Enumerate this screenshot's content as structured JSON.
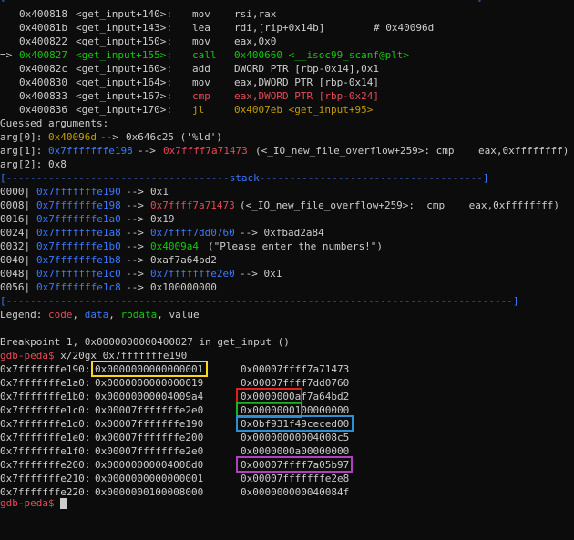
{
  "code_section": {
    "header_label": "code",
    "instructions": [
      {
        "arrow": "",
        "addr": "0x400818",
        "sym": "<get_input+140>:",
        "mnem": "mov",
        "ops": "rsi,rax",
        "comment": ""
      },
      {
        "arrow": "",
        "addr": "0x40081b",
        "sym": "<get_input+143>:",
        "mnem": "lea",
        "ops": "rdi,[rip+0x14b]",
        "comment": "# 0x40096d"
      },
      {
        "arrow": "",
        "addr": "0x400822",
        "sym": "<get_input+150>:",
        "mnem": "mov",
        "ops": "eax,0x0",
        "comment": ""
      },
      {
        "arrow": "=>",
        "addr": "0x400827",
        "sym": "<get_input+155>:",
        "mnem": "call",
        "ops": "0x400660 <__isoc99_scanf@plt>",
        "comment": ""
      },
      {
        "arrow": "",
        "addr": "0x40082c",
        "sym": "<get_input+160>:",
        "mnem": "add",
        "ops": "DWORD PTR [rbp-0x14],0x1",
        "comment": ""
      },
      {
        "arrow": "",
        "addr": "0x400830",
        "sym": "<get_input+164>:",
        "mnem": "mov",
        "ops": "eax,DWORD PTR [rbp-0x14]",
        "comment": ""
      },
      {
        "arrow": "",
        "addr": "0x400833",
        "sym": "<get_input+167>:",
        "mnem": "cmp",
        "ops": "eax,DWORD PTR [rbp-0x24]",
        "comment": ""
      },
      {
        "arrow": "",
        "addr": "0x400836",
        "sym": "<get_input+170>:",
        "mnem": "jl",
        "ops": "0x4007eb <get_input+95>",
        "comment": ""
      }
    ]
  },
  "guessed_arguments": {
    "title": "Guessed arguments:",
    "args": [
      {
        "label": "arg[0]:",
        "ptr": "0x40096d",
        "arrow": "-->",
        "target": "0x646c25 ('%ld')",
        "rest": ""
      },
      {
        "label": "arg[1]:",
        "ptr": "0x7fffffffe198",
        "arrow": "-->",
        "target": "0x7ffff7a71473",
        "rest": "(<_IO_new_file_overflow+259>: cmp    eax,0xffffffff)"
      },
      {
        "label": "arg[2]:",
        "ptr": "",
        "arrow": "",
        "target": "0x8",
        "rest": ""
      }
    ]
  },
  "stack_section": {
    "header_label": "stack",
    "rows": [
      {
        "offset": "0000|",
        "addr": "0x7fffffffe190",
        "arrow": "-->",
        "val": "0x1",
        "rest": ""
      },
      {
        "offset": "0008|",
        "addr": "0x7fffffffe198",
        "arrow": "-->",
        "val": "0x7ffff7a71473",
        "rest": "(<_IO_new_file_overflow+259>:  cmp    eax,0xffffffff)"
      },
      {
        "offset": "0016|",
        "addr": "0x7fffffffe1a0",
        "arrow": "-->",
        "val": "0x19",
        "rest": ""
      },
      {
        "offset": "0024|",
        "addr": "0x7fffffffe1a8",
        "arrow": "-->",
        "val": "0x7ffff7dd0760",
        "rest": "--> 0xfbad2a84"
      },
      {
        "offset": "0032|",
        "addr": "0x7fffffffe1b0",
        "arrow": "-->",
        "val": "0x4009a4",
        "rest": "(\"Please enter the numbers!\")"
      },
      {
        "offset": "0040|",
        "addr": "0x7fffffffe1b8",
        "arrow": "-->",
        "val": "0xaf7a64bd2",
        "rest": ""
      },
      {
        "offset": "0048|",
        "addr": "0x7fffffffe1c0",
        "arrow": "-->",
        "val": "0x7fffffffe2e0",
        "rest": "--> 0x1"
      },
      {
        "offset": "0056|",
        "addr": "0x7fffffffe1c8",
        "arrow": "-->",
        "val": "0x100000000",
        "rest": ""
      }
    ]
  },
  "legend": {
    "label": "Legend:",
    "code": "code",
    "data": "data",
    "rodata": "rodata",
    "value": "value",
    "sep": ","
  },
  "breakpoint_line": "Breakpoint 1, 0x0000000000400827 in get_input ()",
  "prompt": "gdb-peda$",
  "command": "x/20gx 0x7fffffffe190",
  "memory_dump": [
    {
      "addr": "0x7fffffffe190:",
      "v1": "0x0000000000000001",
      "v2": "0x00007ffff7a71473"
    },
    {
      "addr": "0x7fffffffe1a0:",
      "v1": "0x0000000000000019",
      "v2": "0x00007ffff7dd0760"
    },
    {
      "addr": "0x7fffffffe1b0:",
      "v1": "0x00000000004009a4",
      "v2": "0x0000000af7a64bd2"
    },
    {
      "addr": "0x7fffffffe1c0:",
      "v1": "0x00007fffffffe2e0",
      "v2": "0x0000000100000000"
    },
    {
      "addr": "0x7fffffffe1d0:",
      "v1": "0x00007fffffffe190",
      "v2": "0x0bf931f49ceced00"
    },
    {
      "addr": "0x7fffffffe1e0:",
      "v1": "0x00007fffffffe200",
      "v2": "0x00000000004008c5"
    },
    {
      "addr": "0x7fffffffe1f0:",
      "v1": "0x00007fffffffe2e0",
      "v2": "0x0000000a00000000"
    },
    {
      "addr": "0x7fffffffe200:",
      "v1": "0x00000000004008d0",
      "v2": "0x00007ffff7a05b97"
    },
    {
      "addr": "0x7fffffffe210:",
      "v1": "0x0000000000000001",
      "v2": "0x00007fffffffe2e8"
    },
    {
      "addr": "0x7fffffffe220:",
      "v1": "0x0000000100008000",
      "v2": "0x000000000040084f"
    }
  ],
  "colors": {
    "background": "#0c0c0c",
    "text": "#cccccc",
    "code": "#e74856",
    "data": "#3b78ff",
    "rodata": "#16c60c",
    "value": "#cccccc",
    "prompt": "#e74856",
    "ptr_olive": "#c19c00",
    "box_yellow": "#f9d71c",
    "box_red": "#e02020",
    "box_green": "#20b020",
    "box_blue": "#2b8fd6",
    "box_purple": "#b040c0"
  }
}
